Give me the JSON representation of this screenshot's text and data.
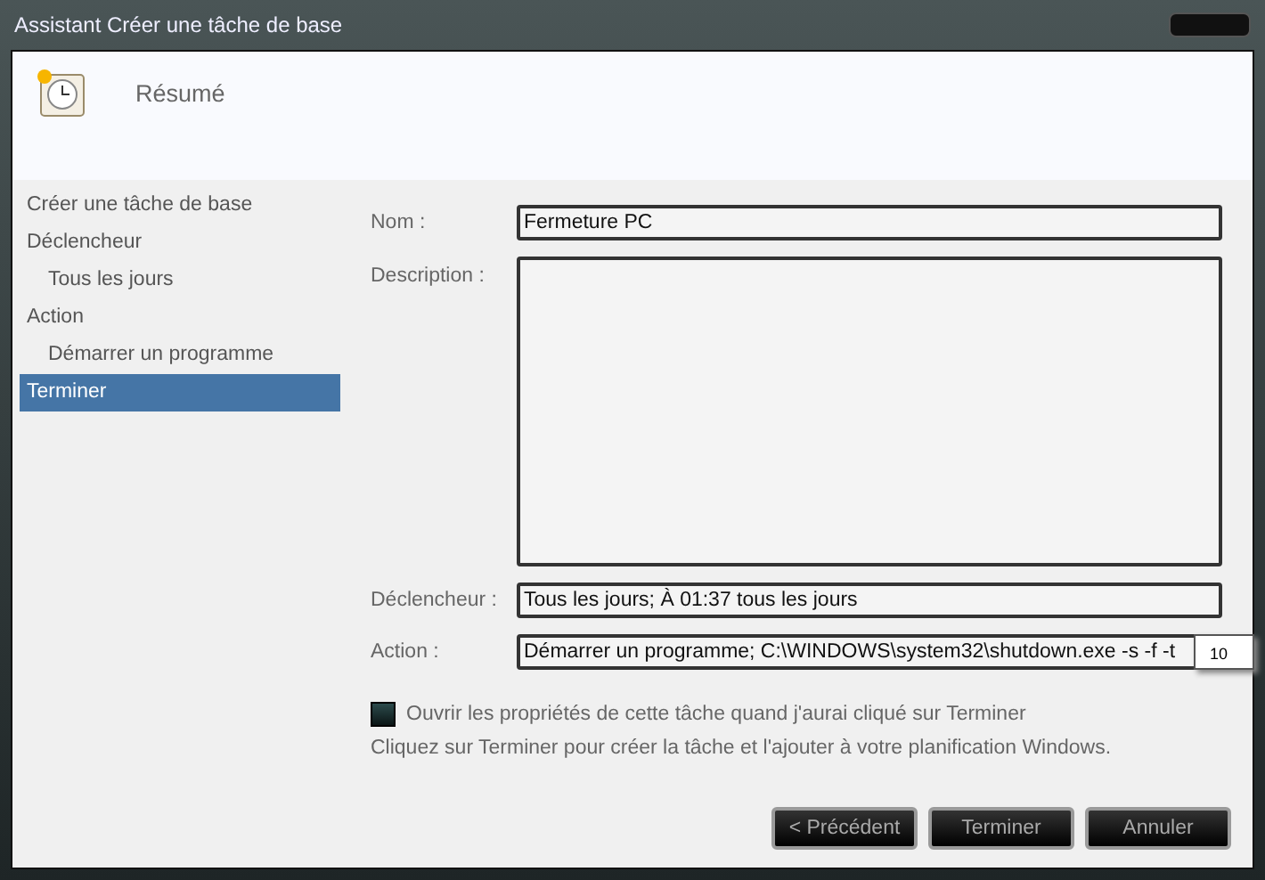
{
  "window": {
    "title": "Assistant Créer une tâche de base"
  },
  "header": {
    "title": "Résumé"
  },
  "sidebar": {
    "items": [
      {
        "label": "Créer une tâche de base",
        "selected": false
      },
      {
        "label": "Déclencheur",
        "selected": false,
        "children": [
          {
            "label": "Tous les jours",
            "selected": false
          }
        ]
      },
      {
        "label": "Action",
        "selected": false,
        "children": [
          {
            "label": "Démarrer un programme",
            "selected": false
          }
        ]
      },
      {
        "label": "Terminer",
        "selected": true
      }
    ]
  },
  "form": {
    "name": {
      "label": "Nom :",
      "value": "Fermeture PC"
    },
    "description": {
      "label": "Description :"
    },
    "trigger": {
      "label": "Déclencheur :",
      "value": "Tous les jours; À 01:37 tous les jours"
    },
    "action": {
      "label": "Action :",
      "value": "Démarrer un programme; C:\\WINDOWS\\system32\\shutdown.exe -s -f -t",
      "tooltip": "10"
    }
  },
  "open_properties": {
    "label": "Ouvrir les propriétés de cette tâche quand j'aurai cliqué sur Terminer",
    "checked": false
  },
  "hint": "Cliquez sur Terminer pour créer la tâche et l'ajouter à votre planification Windows.",
  "buttons": [
    "< Précédent",
    "Terminer",
    "Annuler"
  ]
}
